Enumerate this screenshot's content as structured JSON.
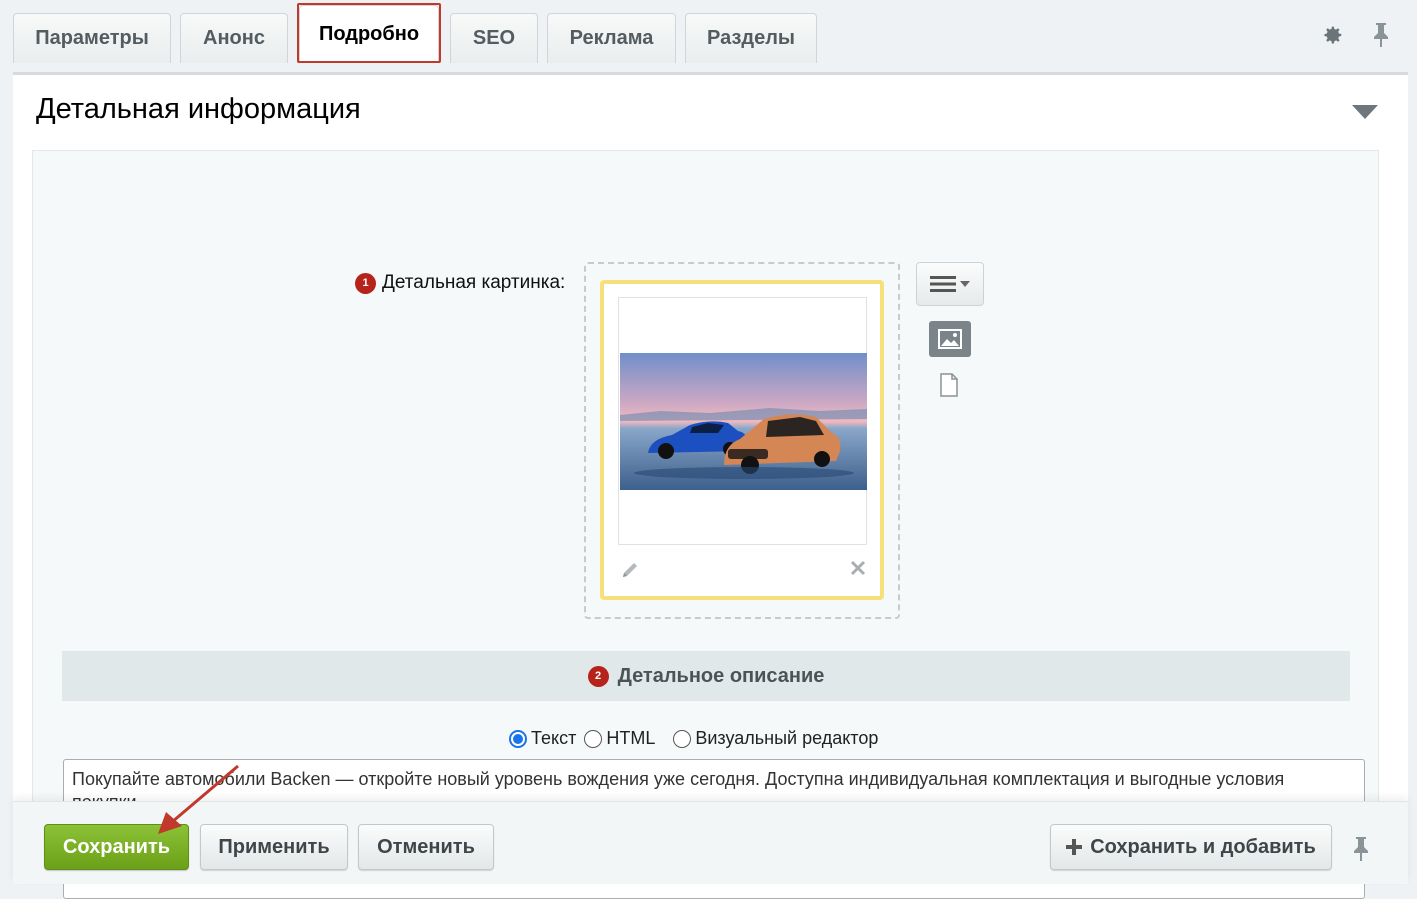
{
  "tabs": [
    {
      "label": "Параметры",
      "active": false
    },
    {
      "label": "Анонс",
      "active": false
    },
    {
      "label": "Подробно",
      "active": true
    },
    {
      "label": "SEO",
      "active": false
    },
    {
      "label": "Реклама",
      "active": false
    },
    {
      "label": "Разделы",
      "active": false
    }
  ],
  "toolbar": {
    "settings_icon": "gear-icon",
    "pin_icon": "pin-icon"
  },
  "section": {
    "title": "Детальная информация"
  },
  "detail_picture": {
    "badge": "1",
    "label": "Детальная картинка:",
    "image_description_icon": "image-thumbnail",
    "menu_icon": "hamburger-menu-icon",
    "type_image_icon": "image-icon",
    "type_file_icon": "file-icon"
  },
  "detail_description": {
    "badge": "2",
    "title": "Детальное описание",
    "modes": [
      {
        "label": "Текст",
        "checked": true
      },
      {
        "label": "HTML",
        "checked": false
      },
      {
        "label": "Визуальный редактор",
        "checked": false
      }
    ],
    "text": "Покупайте автомобили Backen — откройте новый уровень вождения уже сегодня. Доступна индивидуальная комплектация и выгодные условия покупки."
  },
  "footer": {
    "save_label": "Сохранить",
    "apply_label": "Применить",
    "cancel_label": "Отменить",
    "save_add_label": "Сохранить и добавить"
  },
  "colors": {
    "accent_green": "#7ab02a",
    "highlight_red": "#c0392b",
    "badge_red": "#b5231b",
    "card_border": "#f6e07a"
  }
}
